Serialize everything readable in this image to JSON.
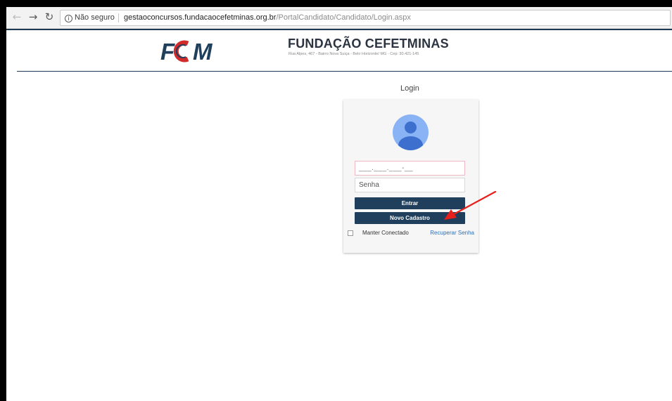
{
  "browser": {
    "security_label": "Não seguro",
    "url_domain": "gestaoconcursos.fundacaocefetminas.org.br",
    "url_path": "/PortalCandidato/Candidato/Login.aspx",
    "icons": [
      "back-arrow-icon",
      "forward-arrow-icon",
      "reload-icon",
      "info-icon"
    ]
  },
  "header": {
    "logo_text": "FCM",
    "title": "FUNDAÇÃO CEFETMINAS",
    "address": "Rua Alpes, 467 - Bairro Nova Suiça - Belo Horizonte/ MG - Cep: 30.421-145"
  },
  "login": {
    "heading": "Login",
    "cpf_mask": "___.___.___-__",
    "password_placeholder": "Senha",
    "login_button": "Entrar",
    "register_button": "Novo Cadastro",
    "remember_label": "Manter Conectado",
    "recover_link": "Recuperar Senha",
    "remember_checked": false
  },
  "colors": {
    "brand_navy": "#1f3f5c",
    "link_blue": "#2f6fb4",
    "logo_red": "#d22b2b",
    "avatar_light": "#8ab3f5",
    "avatar_dark": "#3d6fce",
    "annotation_arrow": "#e8201c"
  }
}
